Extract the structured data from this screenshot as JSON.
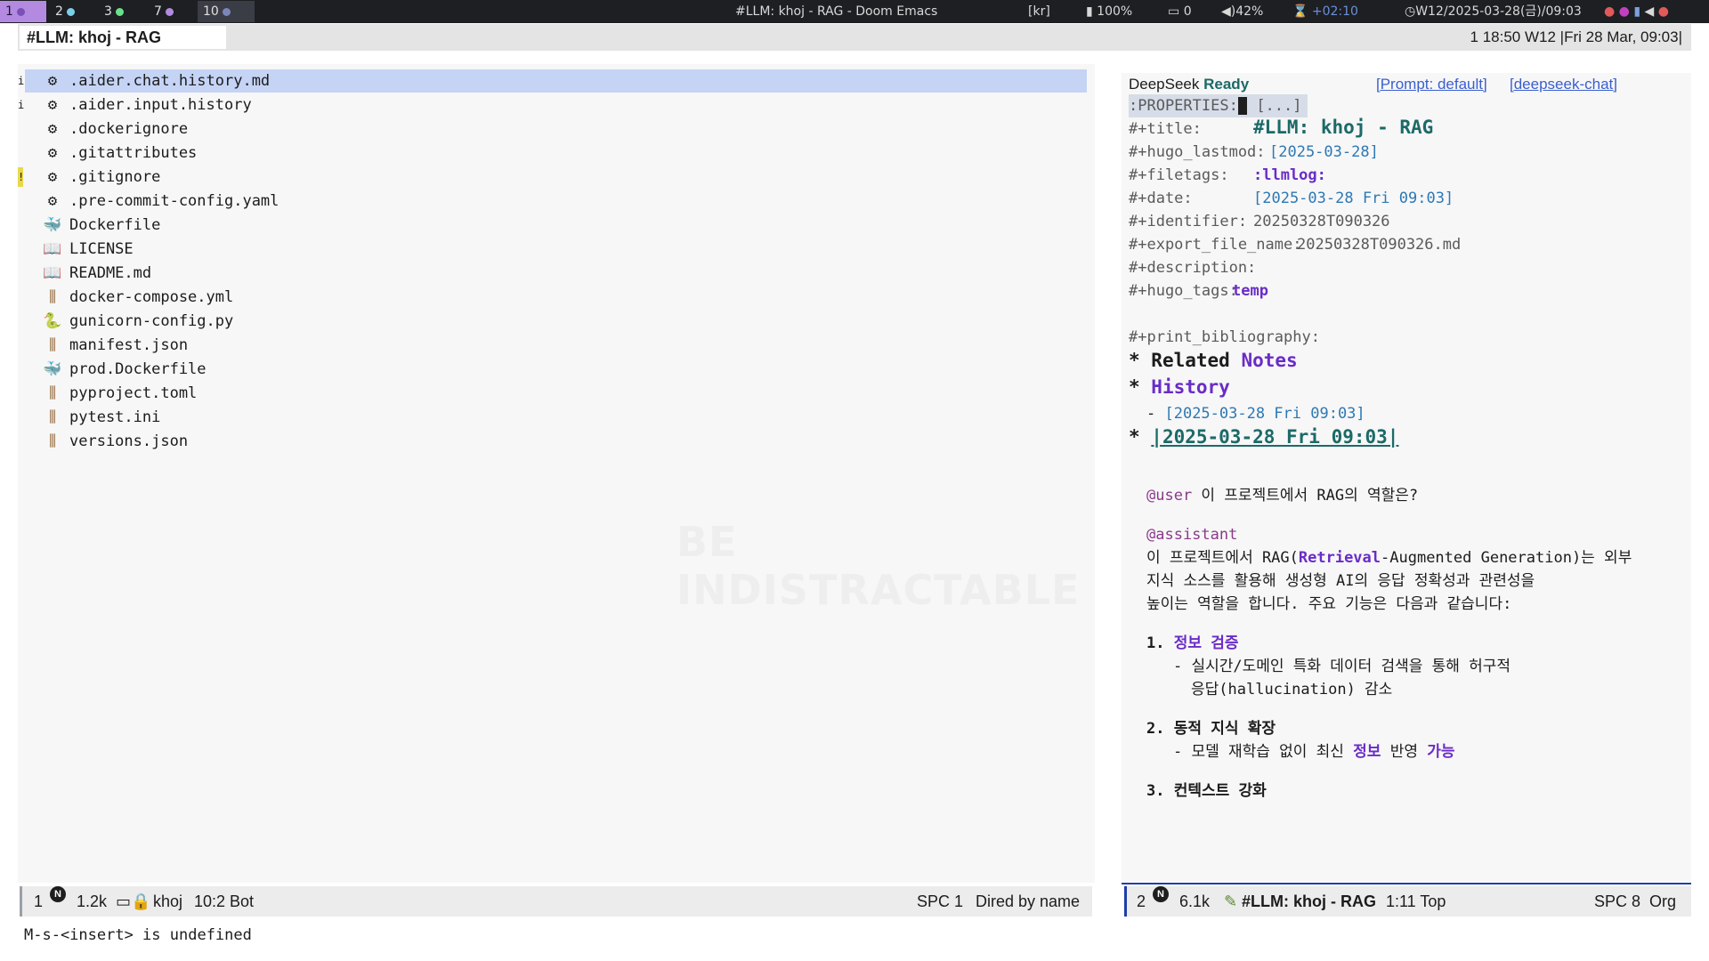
{
  "topbar": {
    "workspaces": [
      {
        "num": "1",
        "dot": "#7a4fb8"
      },
      {
        "num": "2",
        "dot": "#7ad0e8"
      },
      {
        "num": "3",
        "dot": "#6be08a"
      },
      {
        "num": "7",
        "dot": "#b38ae0"
      },
      {
        "num": "10",
        "dot": "#7b86b8"
      }
    ],
    "window_title": "#LLM: khoj - RAG - Doom Emacs",
    "keyboard": "[kr]",
    "battery": "100%",
    "notifications": "0",
    "volume": "42%",
    "timer": "+02:10",
    "datetime": "W12/2025-03-28(금)/09:03"
  },
  "window": {
    "tab_title": "#LLM: khoj - RAG",
    "clock": "1  18:50 W12 |Fri 28 Mar, 09:03|"
  },
  "dired": {
    "files": [
      {
        "name": ".aider.chat.history.md",
        "icon": "gear-icon",
        "mark": "i"
      },
      {
        "name": ".aider.input.history",
        "icon": "gear-icon",
        "mark": "i"
      },
      {
        "name": ".dockerignore",
        "icon": "gear-icon",
        "mark": ""
      },
      {
        "name": ".gitattributes",
        "icon": "gear-icon",
        "mark": ""
      },
      {
        "name": ".gitignore",
        "icon": "gear-icon",
        "mark": "!"
      },
      {
        "name": ".pre-commit-config.yaml",
        "icon": "gear-icon",
        "mark": ""
      },
      {
        "name": "Dockerfile",
        "icon": "docker-icon",
        "mark": ""
      },
      {
        "name": "LICENSE",
        "icon": "book-icon",
        "mark": ""
      },
      {
        "name": "README.md",
        "icon": "book-icon",
        "mark": ""
      },
      {
        "name": "docker-compose.yml",
        "icon": "sliders-icon",
        "mark": ""
      },
      {
        "name": "gunicorn-config.py",
        "icon": "python-icon",
        "mark": ""
      },
      {
        "name": "manifest.json",
        "icon": "sliders-icon",
        "mark": ""
      },
      {
        "name": "prod.Dockerfile",
        "icon": "docker-icon",
        "mark": ""
      },
      {
        "name": "pyproject.toml",
        "icon": "sliders-icon",
        "mark": ""
      },
      {
        "name": "pytest.ini",
        "icon": "sliders-icon",
        "mark": ""
      },
      {
        "name": "versions.json",
        "icon": "sliders-icon",
        "mark": ""
      }
    ],
    "watermark": "BE INDISTRACTABLE",
    "modeline": {
      "window": "1",
      "size": "1.2k",
      "dir": "khoj",
      "pos": "10:2 Bot",
      "keys": "SPC 1",
      "mode": "Dired by name"
    }
  },
  "org": {
    "header": {
      "name": "DeepSeek",
      "status": "Ready",
      "prompt": "[Prompt: default]",
      "model": "[deepseek-chat]"
    },
    "properties": ":PROPERTIES:",
    "properties_fold": " [...]",
    "meta": {
      "title_key": "#+title:",
      "title_val": "#LLM: khoj - RAG",
      "lastmod_key": "#+hugo_lastmod:",
      "lastmod_val": "[2025-03-28]",
      "filetags_key": "#+filetags:",
      "filetags_val": ":llmlog:",
      "date_key": "#+date:",
      "date_val": "[2025-03-28 Fri 09:03]",
      "identifier_key": "#+identifier:",
      "identifier_val": "20250328T090326",
      "export_key": "#+export_file_name:",
      "export_val": "20250328T090326.md",
      "description_key": "#+description:",
      "hugo_tags_key": "#+hugo_tags:",
      "hugo_tags_val": "temp",
      "bib_key": "#+print_bibliography:"
    },
    "headings": {
      "related_a": "Related",
      "related_b": "Notes",
      "history": "History",
      "history_item": "[2025-03-28 Fri 09:03]",
      "timestamp": "|2025-03-28 Fri 09:03|"
    },
    "chat": {
      "user_tag": "@user",
      "user_msg": " 이 프로젝트에서 RAG의 역할은?",
      "assistant_tag": "@assistant",
      "line1_a": "이 프로젝트에서 RAG(",
      "line1_b": "Retrieval",
      "line1_c": "-Augmented Generation)는 외부",
      "line2": "지식 소스를 활용해 생성형 AI의 응답 정확성과 관련성을",
      "line3": "높이는 역할을 합니다. 주요 기능은 다음과 같습니다:",
      "item1_num": "1. ",
      "item1": "정보 검증",
      "item1_sub1": "- 실시간/도메인 특화 데이터 검색을 통해 허구적",
      "item1_sub2": "응답(hallucination) 감소",
      "item2": "2. 동적 지식 확장",
      "item2_sub_a": "- 모델 재학습 없이 최신 ",
      "item2_sub_b": "정보",
      "item2_sub_c": " 반영 ",
      "item2_sub_d": "가능",
      "item3": "3. 컨텍스트 강화"
    },
    "modeline": {
      "window": "2",
      "size": "6.1k",
      "buffer": "#LLM: khoj - RAG",
      "pos": "1:11 Top",
      "keys": "SPC 8",
      "mode": "Org"
    }
  },
  "minibuffer": "M-s-<insert> is undefined"
}
